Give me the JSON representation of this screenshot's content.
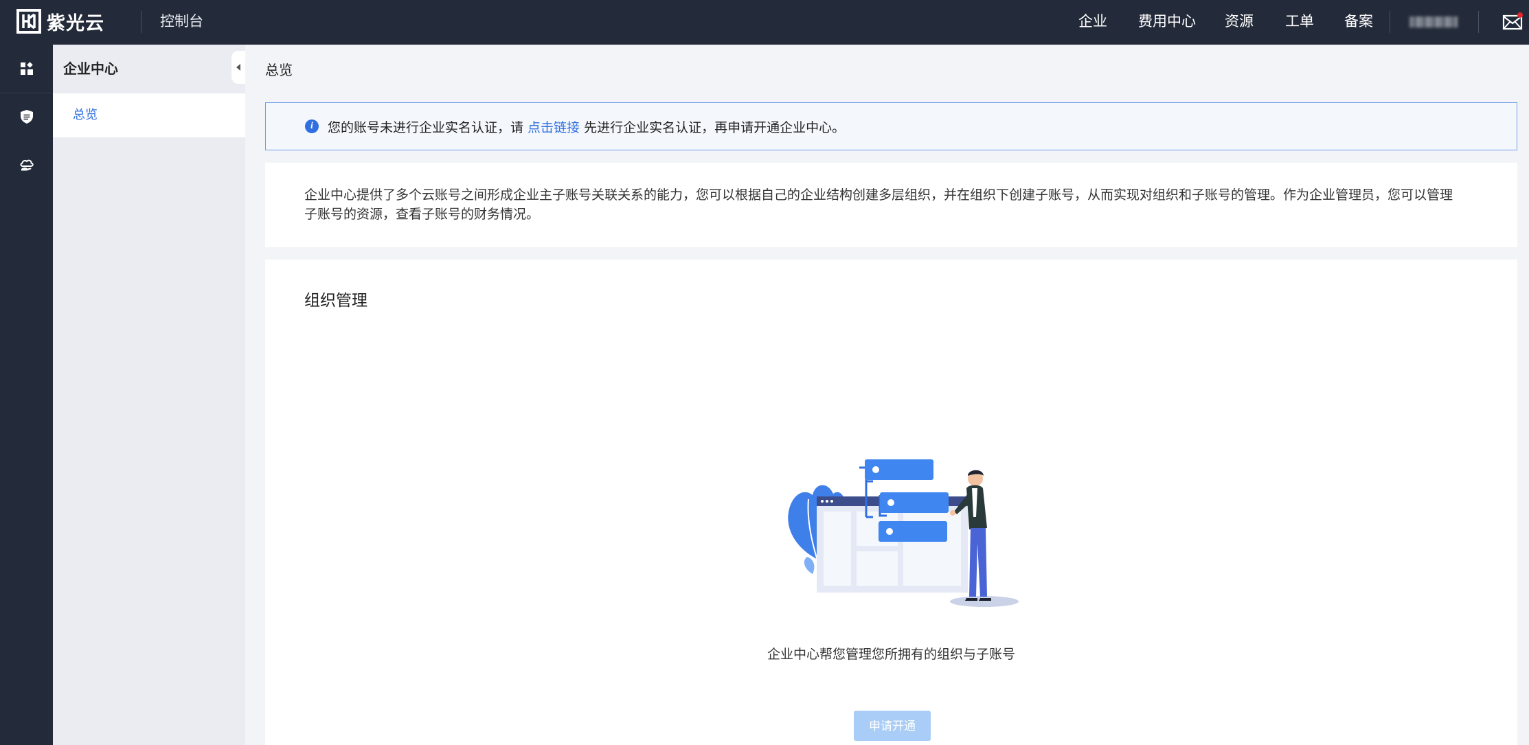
{
  "topbar": {
    "brand": "紫光云",
    "console": "控制台",
    "nav": [
      "企业",
      "费用中心",
      "资源",
      "工单",
      "备案"
    ],
    "icons": {
      "mail": "mail-icon"
    },
    "colors": {
      "background": "#232a39",
      "notification_dot": "#e5262a"
    }
  },
  "rail": {
    "icons": [
      "dashboard-icon",
      "shield-icon",
      "cloud-hand-icon"
    ]
  },
  "sidebar": {
    "title": "企业中心",
    "items": [
      {
        "label": "总览",
        "active": true
      }
    ]
  },
  "main": {
    "page_title": "总览",
    "notice": {
      "before_link": "您的账号未进行企业实名认证，请 ",
      "link": "点击链接",
      "after_link": " 先进行企业实名认证，再申请开通企业中心。"
    },
    "description": "企业中心提供了多个云账号之间形成企业主子账号关联关系的能力，您可以根据自己的企业结构创建多层组织，并在组织下创建子账号，从而实现对组织和子账号的管理。作为企业管理员，您可以管理子账号的资源，查看子账号的财务情况。",
    "org": {
      "title": "组织管理",
      "caption": "企业中心帮您管理您所拥有的组织与子账号",
      "button": "申请开通"
    },
    "colors": {
      "accent": "#2f6fe0",
      "button_disabled": "#a9cdf6"
    }
  }
}
